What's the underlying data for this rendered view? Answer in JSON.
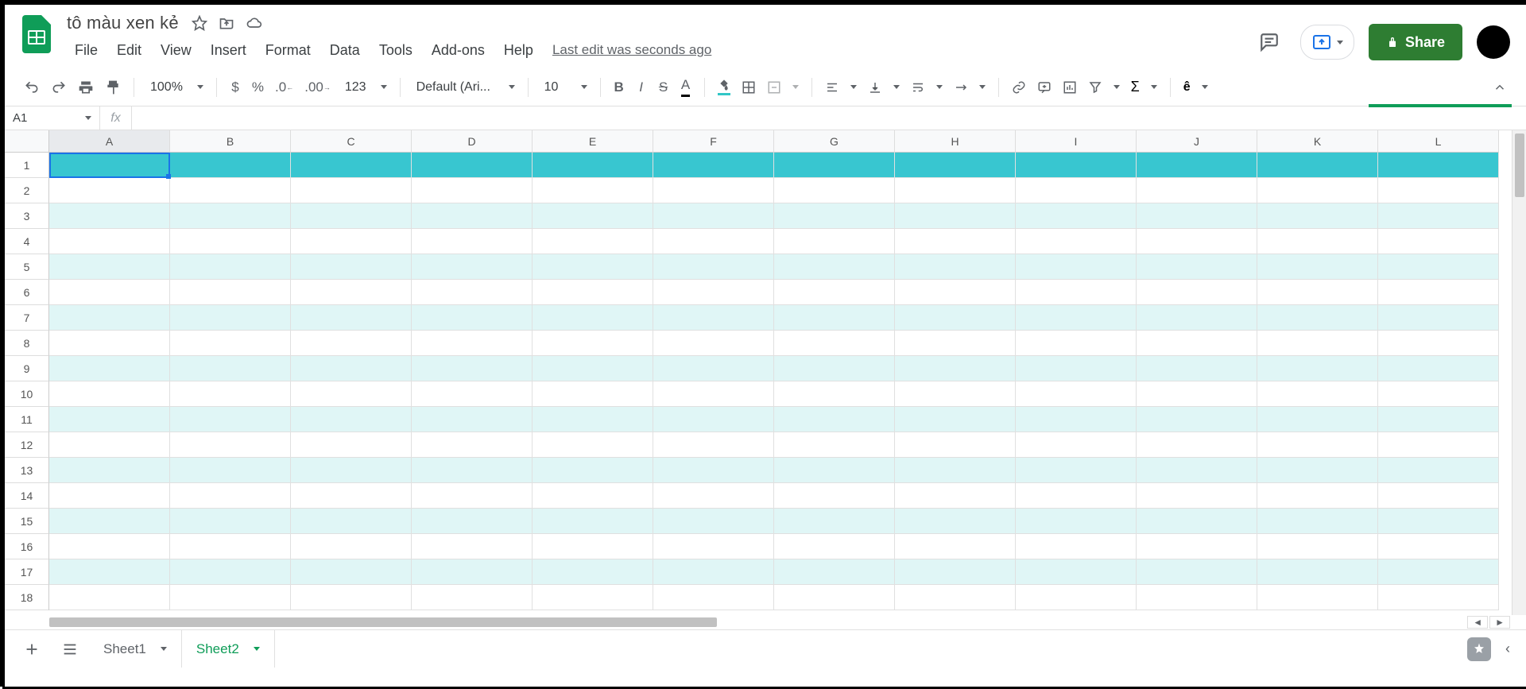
{
  "doc": {
    "title": "tô màu xen kẻ",
    "last_edit": "Last edit was seconds ago"
  },
  "menus": [
    "File",
    "Edit",
    "View",
    "Insert",
    "Format",
    "Data",
    "Tools",
    "Add-ons",
    "Help"
  ],
  "share_label": "Share",
  "toolbar": {
    "zoom": "100%",
    "font": "Default (Ari...",
    "font_size": "10",
    "number_fmt": "123"
  },
  "namebox": "A1",
  "columns": [
    "A",
    "B",
    "C",
    "D",
    "E",
    "F",
    "G",
    "H",
    "I",
    "J",
    "K",
    "L"
  ],
  "rows": [
    "1",
    "2",
    "3",
    "4",
    "5",
    "6",
    "7",
    "8",
    "9",
    "10",
    "11",
    "12",
    "13",
    "14",
    "15",
    "16",
    "17",
    "18"
  ],
  "sheets": [
    {
      "name": "Sheet1",
      "active": false
    },
    {
      "name": "Sheet2",
      "active": true
    }
  ],
  "alt_color": {
    "header": "#38c6d0",
    "band": "#e0f6f6"
  }
}
